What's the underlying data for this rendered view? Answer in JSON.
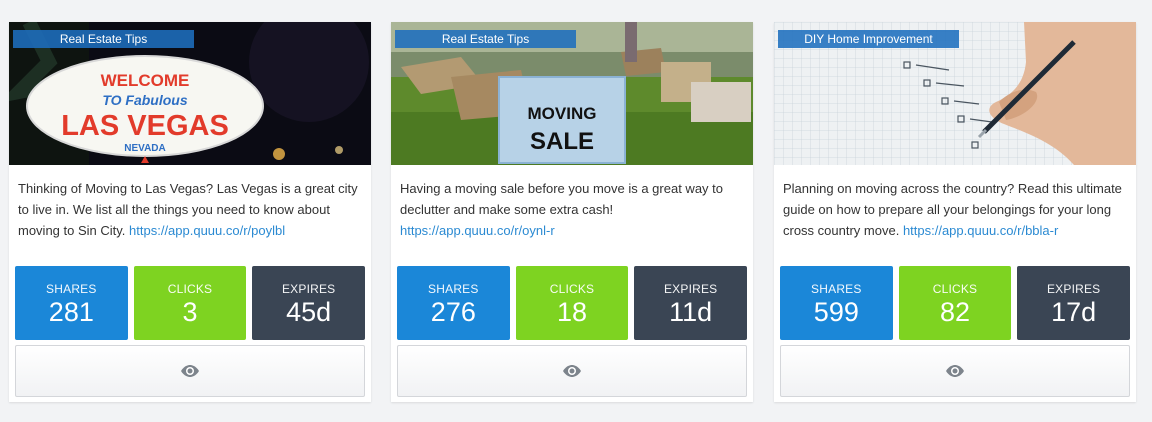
{
  "cards": [
    {
      "category": "Real Estate Tips",
      "image": {
        "sign_line1": "WELCOME",
        "sign_line2": "TO Fabulous",
        "sign_line3": "LAS VEGAS",
        "sign_line4": "NEVADA"
      },
      "description": "Thinking of Moving to Las Vegas? Las Vegas is a great city to live in. We list all the things you need to know about moving to Sin City. ",
      "link": "https://app.quuu.co/r/poylbl",
      "stats": {
        "shares_label": "SHARES",
        "shares": "281",
        "clicks_label": "CLICKS",
        "clicks": "3",
        "expires_label": "EXPIRES",
        "expires": "45d"
      }
    },
    {
      "category": "Real Estate Tips",
      "image": {
        "sign_line1": "MOVING",
        "sign_line2": "SALE"
      },
      "description": "Having a moving sale before you move is a great way to declutter and make some extra cash! ",
      "link": "https://app.quuu.co/r/oynl-r",
      "stats": {
        "shares_label": "SHARES",
        "shares": "276",
        "clicks_label": "CLICKS",
        "clicks": "18",
        "expires_label": "EXPIRES",
        "expires": "11d"
      }
    },
    {
      "category": "DIY Home Improvement",
      "description": "Planning on moving across the country? Read this ultimate guide on how to prepare all your belongings for your long cross country move. ",
      "link": "https://app.quuu.co/r/bbla-r",
      "stats": {
        "shares_label": "SHARES",
        "shares": "599",
        "clicks_label": "CLICKS",
        "clicks": "82",
        "expires_label": "EXPIRES",
        "expires": "17d"
      }
    }
  ],
  "icons": {
    "preview": "eye-icon"
  },
  "colors": {
    "shares": "#1b87d8",
    "clicks": "#7ed321",
    "expires": "#3a4554",
    "link": "#2b8ad2",
    "category_badge": "#1e6ebe"
  }
}
